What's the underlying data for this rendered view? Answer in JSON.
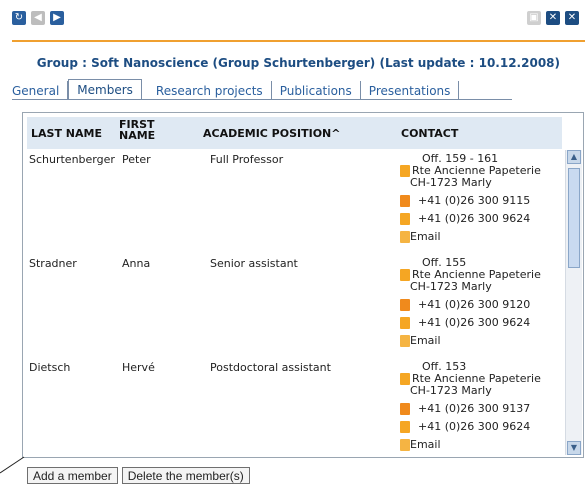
{
  "toolbar": {
    "icons_left": [
      "refresh-icon",
      "prev-icon",
      "next-icon"
    ],
    "icons_right": [
      "save-icon",
      "toggle-icon",
      "close-icon"
    ]
  },
  "group": {
    "title": "Group : Soft Nanoscience (Group Schurtenberger) (Last update : 10.12.2008)"
  },
  "tabs": [
    {
      "label": "General"
    },
    {
      "label": "Members"
    },
    {
      "label": "Research projects"
    },
    {
      "label": "Publications"
    },
    {
      "label": "Presentations"
    }
  ],
  "table": {
    "columns": [
      "LAST NAME",
      "FIRST NAME",
      "ACADEMIC POSITION^",
      "CONTACT"
    ],
    "rows": [
      {
        "last_name": "Schurtenberger",
        "first_name": "Peter",
        "position": "Full Professor",
        "office": "Off. 159 - 161",
        "address1": "Rte Ancienne Papeterie",
        "address2": "CH-1723 Marly",
        "phone": "+41 (0)26 300 9115",
        "fax": "+41 (0)26 300 9624",
        "email": "Email"
      },
      {
        "last_name": "Stradner",
        "first_name": "Anna",
        "position": "Senior assistant",
        "office": "Off. 155",
        "address1": "Rte Ancienne Papeterie",
        "address2": "CH-1723 Marly",
        "phone": "+41 (0)26 300 9120",
        "fax": "+41 (0)26 300 9624",
        "email": "Email"
      },
      {
        "last_name": "Dietsch",
        "first_name": "Hervé",
        "position": "Postdoctoral assistant",
        "office": "Off. 153",
        "address1": "Rte Ancienne Papeterie",
        "address2": "CH-1723 Marly",
        "phone": "+41 (0)26 300 9137",
        "fax": "+41 (0)26 300 9624",
        "email": "Email"
      }
    ]
  },
  "actions": {
    "add_label": "Add a member",
    "delete_label": "Delete the member(s)"
  },
  "colors": {
    "accent_orange": "#f0a030",
    "title_blue": "#1d4d82",
    "header_bg": "#dfe9f3"
  }
}
